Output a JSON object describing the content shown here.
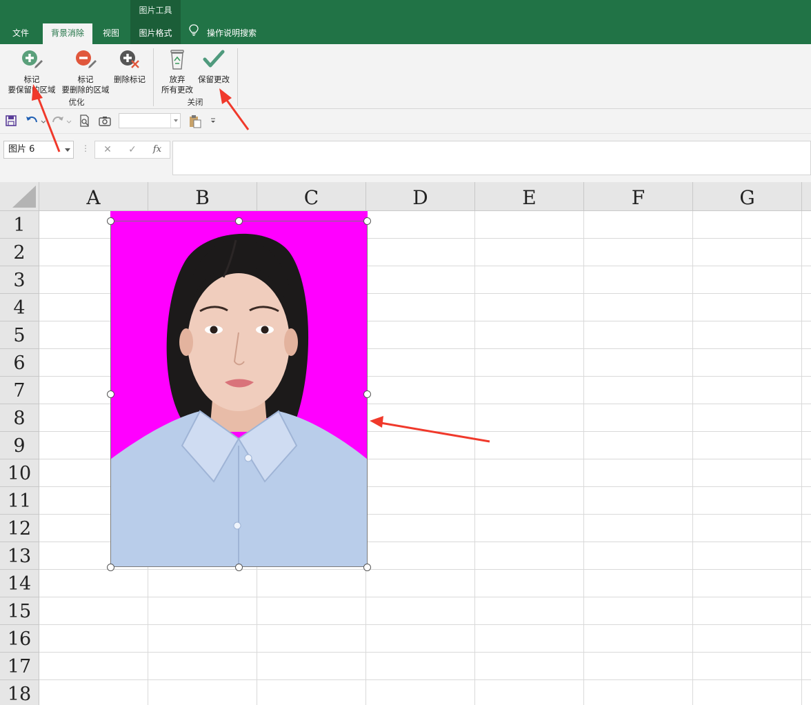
{
  "ribbon_tabs": {
    "context_group": "图片工具",
    "file": "文件",
    "background_removal": "背景消除",
    "view": "视图",
    "picture_format": "图片格式",
    "tell_me": "操作说明搜索"
  },
  "ribbon": {
    "mark_keep_line1": "标记",
    "mark_keep_line2": "要保留的区域",
    "mark_remove_line1": "标记",
    "mark_remove_line2": "要删除的区域",
    "delete_mark": "删除标记",
    "refine_group": "优化",
    "discard_line1": "放弃",
    "discard_line2": "所有更改",
    "keep_changes": "保留更改",
    "close_group": "关闭"
  },
  "qat_icons": [
    "save-icon",
    "undo-icon",
    "redo-icon",
    "print-preview-icon",
    "camera-icon",
    "paste-icon",
    "customize-icon"
  ],
  "formula_bar": {
    "name_box": "图片 6",
    "cancel": "✕",
    "enter": "✓",
    "fx": "fx",
    "content": ""
  },
  "sheet": {
    "columns": [
      "A",
      "B",
      "C",
      "D",
      "E",
      "F",
      "G"
    ],
    "rows": [
      "1",
      "2",
      "3",
      "4",
      "5",
      "6",
      "7",
      "8",
      "9",
      "10",
      "11",
      "12",
      "13",
      "14",
      "15",
      "16",
      "17",
      "18"
    ]
  },
  "colors": {
    "excel_green": "#217346",
    "removal_magenta": "#ff00ff",
    "annotation_red": "#f0392b"
  }
}
